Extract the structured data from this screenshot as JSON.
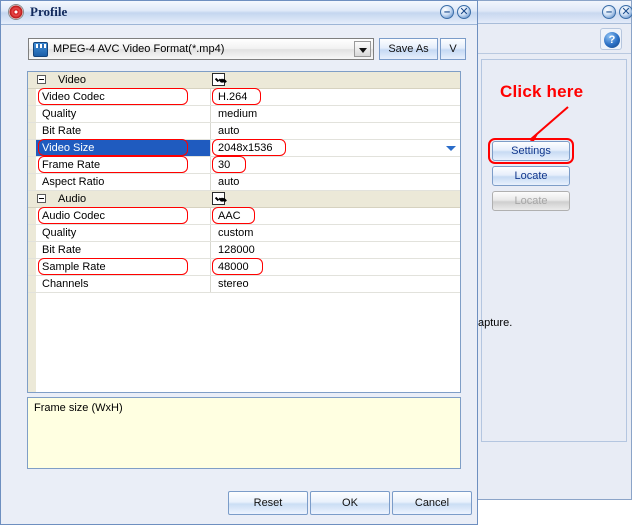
{
  "parent_window": {
    "titlebar": {
      "minimize_label": "–",
      "close_label": "✕"
    },
    "help_button_label": "?",
    "annotation": {
      "click_here_text": "Click here",
      "color": "#ff0000"
    },
    "buttons": [
      {
        "label": "Settings",
        "state": "enabled",
        "highlighted": true
      },
      {
        "label": "Locate",
        "state": "enabled",
        "highlighted": false
      },
      {
        "label": "Locate",
        "state": "disabled",
        "highlighted": false
      }
    ],
    "partial_text": "apture."
  },
  "dialog": {
    "title": "Profile",
    "icon": "profile-gear-icon",
    "minimize_label": "–",
    "close_label": "✕",
    "profile_combo": {
      "value": "MPEG-4 AVC Video Format(*.mp4)",
      "icon": "video-format-icon"
    },
    "save_as_label": "Save As",
    "v_label": "V",
    "description": "Frame size (WxH)",
    "footer_buttons": [
      {
        "label": "Reset"
      },
      {
        "label": "OK"
      },
      {
        "label": "Cancel"
      }
    ],
    "grid": {
      "rows": [
        {
          "type": "category",
          "label": "Video",
          "checked": true,
          "highlight_label": false,
          "highlight_value": false,
          "selected": false,
          "value": ""
        },
        {
          "type": "property",
          "label": "Video Codec",
          "value": "H.264",
          "highlight_label": true,
          "highlight_value": true,
          "selected": false
        },
        {
          "type": "property",
          "label": "Quality",
          "value": "medium",
          "highlight_label": false,
          "highlight_value": false,
          "selected": false
        },
        {
          "type": "property",
          "label": "Bit Rate",
          "value": "auto",
          "highlight_label": false,
          "highlight_value": false,
          "selected": false
        },
        {
          "type": "property",
          "label": "Video Size",
          "value": "2048x1536",
          "highlight_label": true,
          "highlight_value": true,
          "selected": true,
          "dropdown": true
        },
        {
          "type": "property",
          "label": "Frame Rate",
          "value": "30",
          "highlight_label": true,
          "highlight_value": true,
          "selected": false
        },
        {
          "type": "property",
          "label": "Aspect Ratio",
          "value": "auto",
          "highlight_label": false,
          "highlight_value": false,
          "selected": false
        },
        {
          "type": "category",
          "label": "Audio",
          "checked": true,
          "highlight_label": false,
          "highlight_value": false,
          "selected": false,
          "value": ""
        },
        {
          "type": "property",
          "label": "Audio Codec",
          "value": "AAC",
          "highlight_label": true,
          "highlight_value": true,
          "selected": false
        },
        {
          "type": "property",
          "label": "Quality",
          "value": "custom",
          "highlight_label": false,
          "highlight_value": false,
          "selected": false
        },
        {
          "type": "property",
          "label": "Bit Rate",
          "value": "128000",
          "highlight_label": false,
          "highlight_value": false,
          "selected": false
        },
        {
          "type": "property",
          "label": "Sample Rate",
          "value": "48000",
          "highlight_label": true,
          "highlight_value": true,
          "selected": false
        },
        {
          "type": "property",
          "label": "Channels",
          "value": "stereo",
          "highlight_label": false,
          "highlight_value": false,
          "selected": false
        }
      ]
    }
  }
}
